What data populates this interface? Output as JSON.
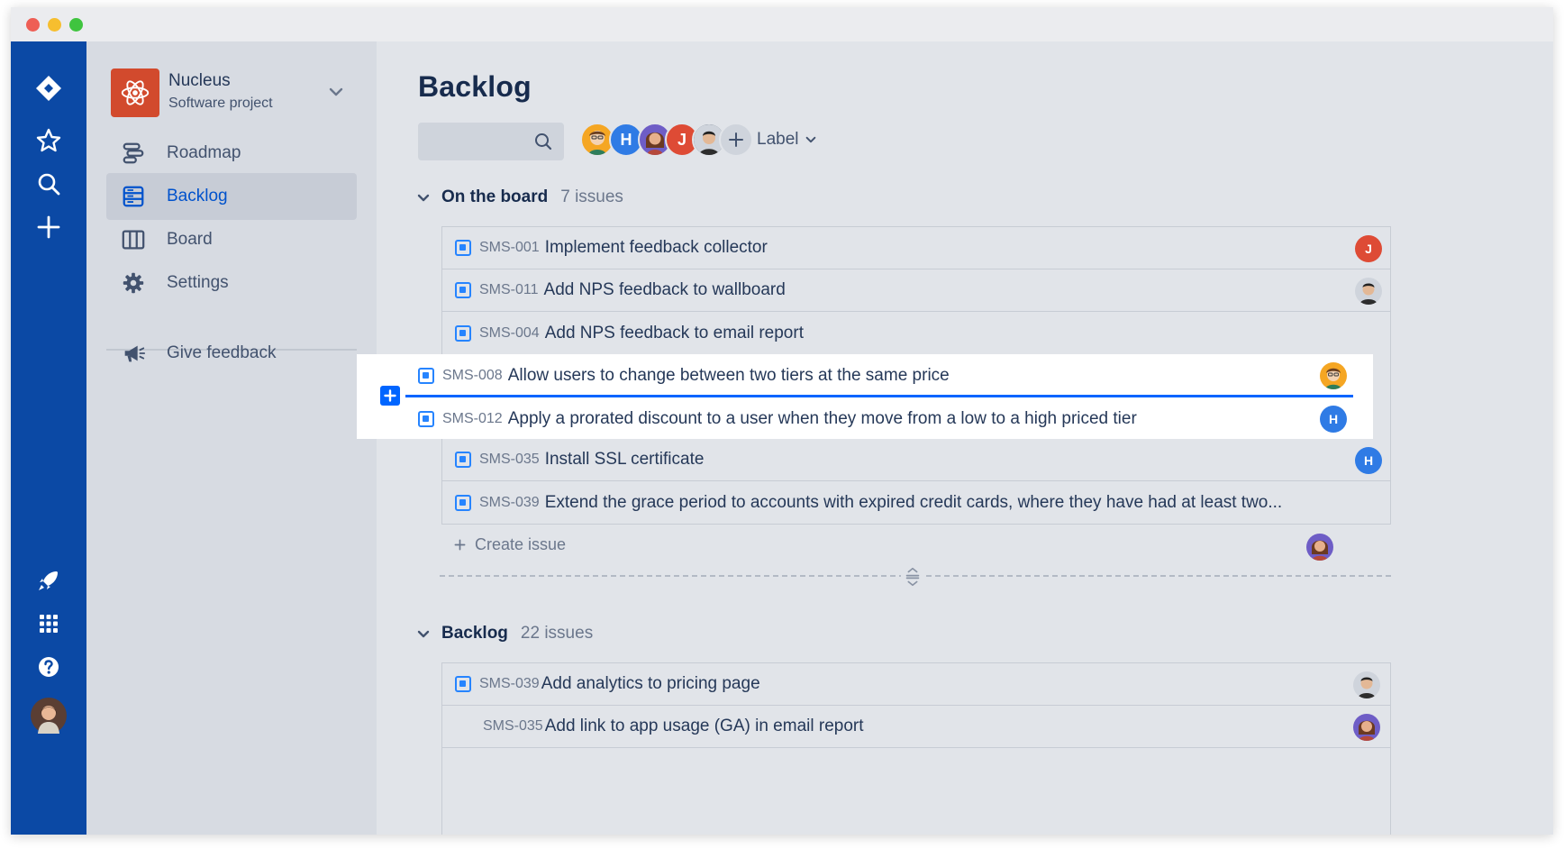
{
  "window": {
    "controls": [
      "close",
      "minimize",
      "maximize"
    ]
  },
  "global_nav": {
    "icons": [
      "jira-logo-icon",
      "star-icon",
      "search-icon",
      "create-icon",
      "rocket-icon",
      "app-switcher-icon",
      "help-icon",
      "user-avatar"
    ]
  },
  "project": {
    "name": "Nucleus",
    "type": "Software project",
    "nav": [
      {
        "label": "Roadmap",
        "icon": "roadmap-icon",
        "active": false
      },
      {
        "label": "Backlog",
        "icon": "backlog-icon",
        "active": true
      },
      {
        "label": "Board",
        "icon": "board-icon",
        "active": false
      },
      {
        "label": "Settings",
        "icon": "gear-icon",
        "active": false
      }
    ],
    "feedback_label": "Give feedback"
  },
  "main": {
    "title": "Backlog",
    "search": {
      "placeholder": ""
    },
    "filter_avatars": [
      {
        "initial": "",
        "color": "#F5A623"
      },
      {
        "initial": "H",
        "color": "#2F7BE5"
      },
      {
        "initial": "",
        "color": "#6E5DC6"
      },
      {
        "initial": "J",
        "color": "#DE4B35"
      },
      {
        "initial": "",
        "color": "#3B4A5E"
      }
    ],
    "label_filter": "Label"
  },
  "on_the_board": {
    "name": "On the board",
    "count": "7 issues",
    "issues": [
      {
        "key": "SMS-001",
        "summary": "Implement feedback collector",
        "assignee": "J",
        "assignee_color": "#DE4B35"
      },
      {
        "key": "SMS-011",
        "summary": "Add NPS feedback to wallboard",
        "assignee": "",
        "assignee_color": "#3B4A5E"
      },
      {
        "key": "SMS-004",
        "summary": "Add NPS feedback to email report",
        "assignee": null,
        "assignee_color": null
      }
    ],
    "highlighted": [
      {
        "key": "SMS-008",
        "summary": "Allow users to change between two tiers at the same price",
        "assignee": "",
        "assignee_color": "#F5A623"
      },
      {
        "key": "SMS-012",
        "summary": "Apply a prorated discount to a user when they move from a low to a high priced tier",
        "assignee": "H",
        "assignee_color": "#2F7BE5"
      }
    ],
    "issues_after": [
      {
        "key": "SMS-035",
        "summary": "Install SSL certificate",
        "assignee": "H",
        "assignee_color": "#2F7BE5"
      },
      {
        "key": "SMS-039",
        "summary": "Extend the grace period to accounts with expired credit cards, where they have had at least two...",
        "assignee": null,
        "assignee_color": null
      }
    ],
    "create_label": "Create issue",
    "create_avatar_color": "#6E5DC6"
  },
  "backlog": {
    "name": "Backlog",
    "count": "22 issues",
    "issues": [
      {
        "key": "SMS-039",
        "summary": "Add analytics to pricing page",
        "assignee": "",
        "assignee_color": "#3B4A5E",
        "show_type_icon": true
      },
      {
        "key": "SMS-035",
        "summary": "Add link to app usage (GA) in email report",
        "assignee": "",
        "assignee_color": "#6E5DC6",
        "show_type_icon": false
      }
    ]
  }
}
